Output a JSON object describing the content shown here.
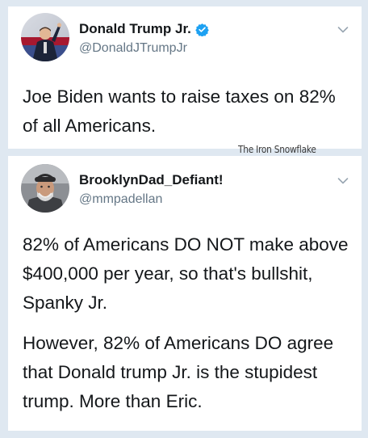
{
  "tweets": [
    {
      "display_name": "Donald Trump Jr.",
      "handle": "@DonaldJTrumpJr",
      "verified": true,
      "text": "Joe Biden wants to raise taxes on 82% of all Americans."
    },
    {
      "display_name": "BrooklynDad_Defiant!",
      "handle": "@mmpadellan",
      "verified": false,
      "paragraphs": [
        "82% of Americans DO NOT make above $400,000 per year, so that's bullshit, Spanky Jr.",
        "However, 82% of Americans DO agree that Donald trump Jr. is the stupidest trump. More than Eric."
      ]
    }
  ],
  "watermark": "The Iron Snowflake",
  "colors": {
    "background": "#dfe8f1",
    "card": "#ffffff",
    "text": "#14171a",
    "secondary_text": "#657786",
    "verified_badge": "#1da1f2"
  },
  "icons": {
    "verified": "verified-badge-icon",
    "menu": "chevron-down-icon"
  }
}
